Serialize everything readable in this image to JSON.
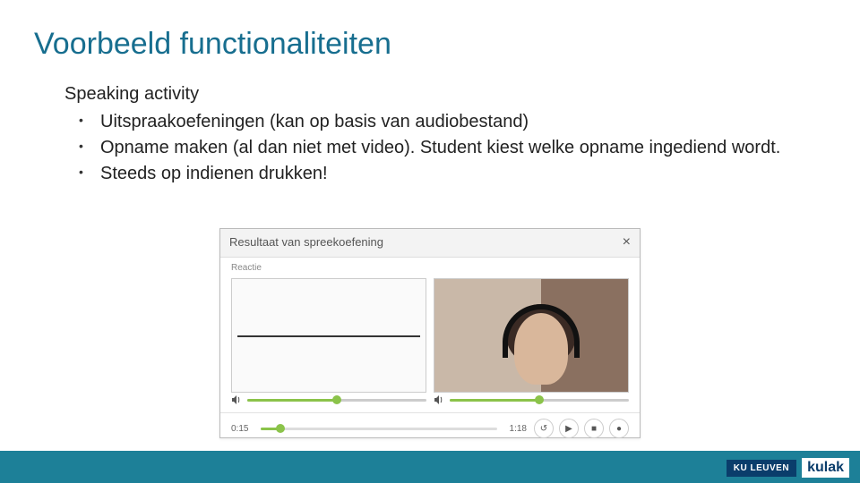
{
  "title": "Voorbeeld functionaliteiten",
  "body": {
    "heading": "Speaking activity",
    "bullets": [
      "Uitspraakoefeningen (kan op basis van audiobestand)",
      "Opname maken (al dan niet met video). Student kiest welke opname ingediend wordt.",
      "Steeds op indienen drukken!"
    ]
  },
  "dialog": {
    "title": "Resultaat van spreekoefening",
    "close_glyph": "×",
    "sub_label": "Reactie",
    "time_elapsed": "0:15",
    "time_total": "1:18",
    "buttons": {
      "restart": "↺",
      "play": "▶",
      "stop": "■",
      "record": "●"
    }
  },
  "footer": {
    "logo_ku": "KU LEUVEN",
    "logo_kulak": "kulak"
  }
}
